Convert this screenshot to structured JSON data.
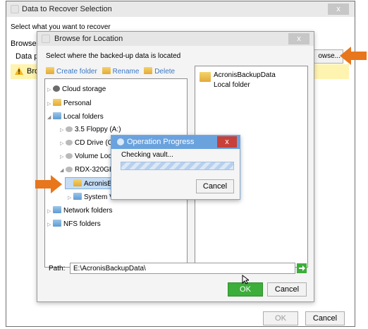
{
  "outer": {
    "title": "Data to Recover Selection",
    "close": "x",
    "prompt": "Select what you want to recover",
    "browse_label": "Browse",
    "data_path_label": "Data pa",
    "warning_text": "Brow",
    "browse_button": "owse...",
    "ok": "OK",
    "cancel": "Cancel"
  },
  "browse": {
    "title": "Browse for Location",
    "close": "x",
    "instruction": "Select where the backed-up data is located",
    "toolbar": {
      "create_folder": "Create folder",
      "rename": "Rename",
      "delete": "Delete"
    },
    "tree": [
      "Cloud storage",
      "Personal",
      "Local folders",
      "3.5 Floppy (A:)",
      "CD Drive (C:",
      "Volume Lock",
      "RDX-320GB",
      "AcronisBa",
      "System V",
      "Network folders",
      "NFS folders"
    ],
    "right_item": {
      "name": "AcronisBackupData",
      "subtitle": "Local folder"
    },
    "path_label": "Path:",
    "path_value": "E:\\AcronisBackupData\\",
    "ok": "OK",
    "cancel": "Cancel"
  },
  "progress": {
    "title": "Operation Progress",
    "status": "Checking vault...",
    "cancel": "Cancel",
    "close": "x"
  },
  "colors": {
    "accent_orange": "#e8761c",
    "ok_green": "#3cae3a",
    "link_blue": "#3a78c2",
    "progress_title": "#6aa2de",
    "warning_bg": "#fff3b0"
  }
}
